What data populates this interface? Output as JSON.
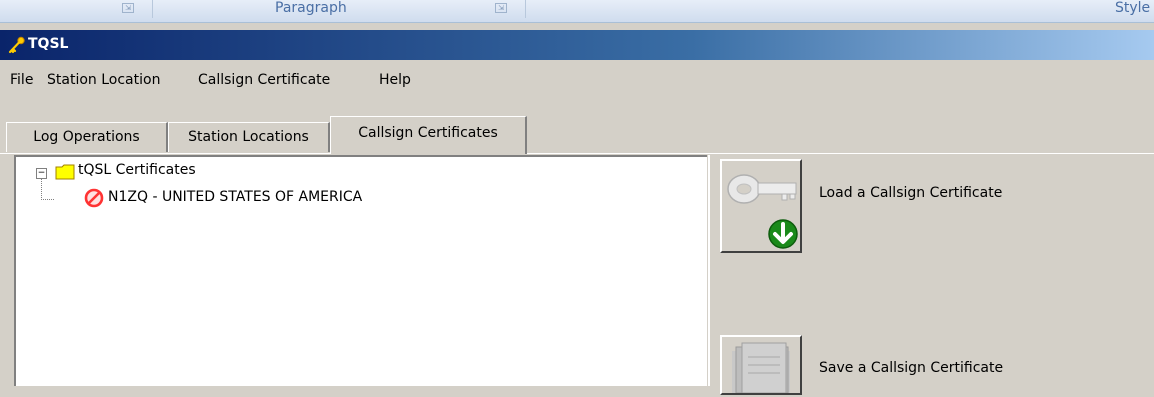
{
  "ribbon": {
    "groups": [
      {
        "label": "Paragraph"
      },
      {
        "label": "Style"
      }
    ],
    "launcher_glyph": "⇲"
  },
  "window": {
    "title": "TQSL",
    "icon": "key-icon"
  },
  "menu": {
    "items": [
      {
        "label": "File"
      },
      {
        "label": "Station Location"
      },
      {
        "label": "Callsign Certificate"
      },
      {
        "label": "Help"
      }
    ]
  },
  "tabs": [
    {
      "label": "Log Operations",
      "active": false
    },
    {
      "label": "Station Locations",
      "active": false
    },
    {
      "label": "Callsign Certificates",
      "active": true
    }
  ],
  "tree": {
    "toggle": "−",
    "root_label": "tQSL Certificates",
    "root_icon": "folder-icon",
    "children": [
      {
        "label": "N1ZQ - UNITED STATES OF AMERICA",
        "icon": "invalid-certificate-icon"
      }
    ]
  },
  "actions": {
    "load_label": "Load a Callsign Certificate",
    "load_icon": "key-download-icon",
    "save_label": "Save a Callsign Certificate",
    "save_icon": "save-certificate-icon"
  },
  "colors": {
    "titlebar_start": "#0a246a",
    "titlebar_end": "#a6caf0",
    "face": "#d4d0c8",
    "folder": "#ffff00",
    "no_symbol": "#ff3333",
    "download_green": "#1a8a1a"
  }
}
